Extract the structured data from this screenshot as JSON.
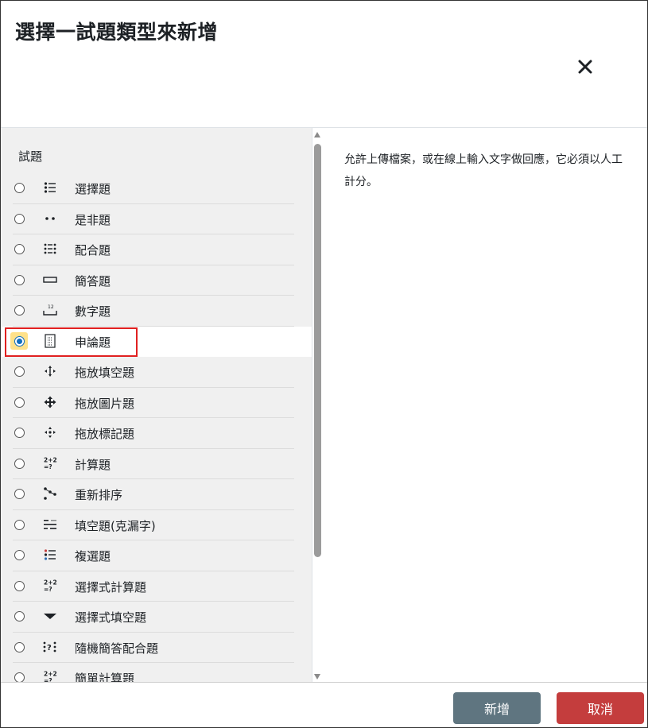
{
  "dialog": {
    "title": "選擇一試題類型來新增"
  },
  "left": {
    "section_label": "試題",
    "items": [
      {
        "label": "選擇題",
        "icon": "multichoice-list-icon",
        "selected": false
      },
      {
        "label": "是非題",
        "icon": "truefalse-dots-icon",
        "selected": false
      },
      {
        "label": "配合題",
        "icon": "match-grid-icon",
        "selected": false
      },
      {
        "label": "簡答題",
        "icon": "shortanswer-box-icon",
        "selected": false
      },
      {
        "label": "數字題",
        "icon": "numerical-icon",
        "selected": false
      },
      {
        "label": "申論題",
        "icon": "essay-document-icon",
        "selected": true
      },
      {
        "label": "拖放填空題",
        "icon": "drag-text-icon",
        "selected": false
      },
      {
        "label": "拖放圖片題",
        "icon": "drag-image-icon",
        "selected": false
      },
      {
        "label": "拖放標記題",
        "icon": "drag-marker-icon",
        "selected": false
      },
      {
        "label": "計算題",
        "icon": "calculated-icon",
        "selected": false
      },
      {
        "label": "重新排序",
        "icon": "ordering-icon",
        "selected": false
      },
      {
        "label": "填空題(克漏字)",
        "icon": "cloze-icon",
        "selected": false
      },
      {
        "label": "複選題",
        "icon": "multianswer-icon",
        "selected": false
      },
      {
        "label": "選擇式計算題",
        "icon": "calculated-multi-icon",
        "selected": false
      },
      {
        "label": "選擇式填空題",
        "icon": "select-missing-icon",
        "selected": false
      },
      {
        "label": "隨機簡答配合題",
        "icon": "random-match-icon",
        "selected": false
      },
      {
        "label": "簡單計算題",
        "icon": "calculated-simple-icon",
        "selected": false
      }
    ]
  },
  "description": {
    "text": "允許上傳檔案，或在線上輸入文字做回應，它必須以人工計分。"
  },
  "footer": {
    "add_label": "新增",
    "cancel_label": "取消"
  },
  "colors": {
    "add_button": "#5f7580",
    "cancel_button": "#c43d3d",
    "selection_outline": "#e02020",
    "radio_highlight": "#ffe18a"
  }
}
